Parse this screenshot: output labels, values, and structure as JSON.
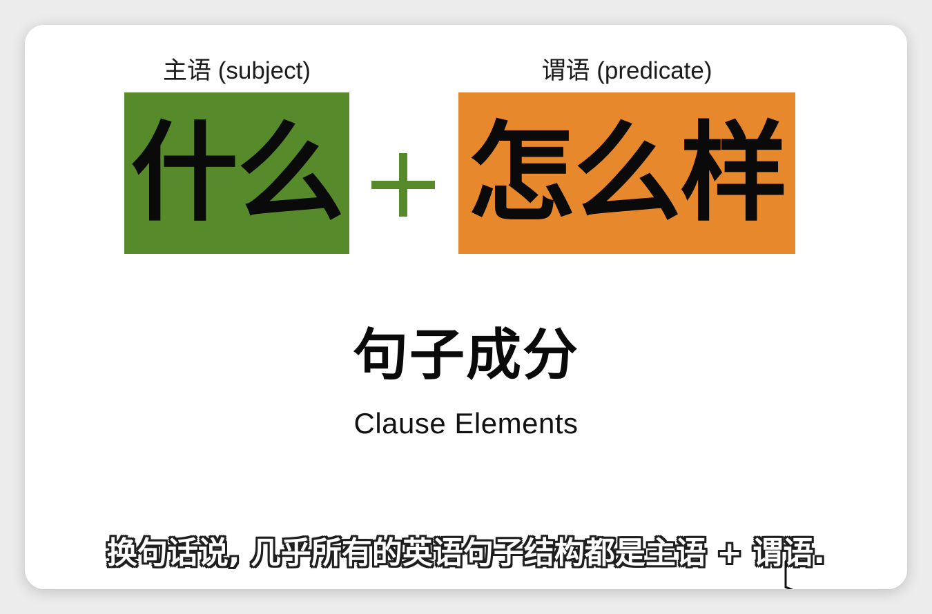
{
  "subject": {
    "label": "主语 (subject)",
    "word": "什么",
    "color": "#568a2a"
  },
  "plus": {
    "icon": "plus-icon",
    "color": "#568a2a"
  },
  "predicate": {
    "label": "谓语 (predicate)",
    "word": "怎么样",
    "color": "#e8882c"
  },
  "title": {
    "zh": "句子成分",
    "en": "Clause Elements"
  },
  "subtitle": {
    "text": "换句话说, 几乎所有的英语句子结构都是主语 + 谓语."
  },
  "cursor": {
    "icon": "text-cursor-icon"
  }
}
